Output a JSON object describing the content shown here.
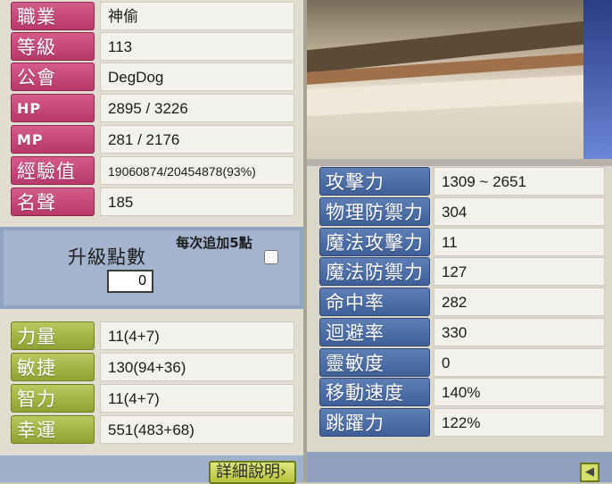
{
  "left": {
    "rows": [
      {
        "label": "職業",
        "value": "神偷"
      },
      {
        "label": "等級",
        "value": "113"
      },
      {
        "label": "公會",
        "value": "DegDog"
      },
      {
        "label": "HP",
        "value": "2895 / 3226"
      },
      {
        "label": "MP",
        "value": "281 / 2176"
      },
      {
        "label": "經驗值",
        "value": "19060874/20454878(93%)"
      },
      {
        "label": "名聲",
        "value": "185"
      }
    ],
    "points": {
      "title": "升級點數",
      "value": "0",
      "each_label": "每次追加5點"
    },
    "stats": [
      {
        "label": "力量",
        "value": "11(4+7)"
      },
      {
        "label": "敏捷",
        "value": "130(94+36)"
      },
      {
        "label": "智力",
        "value": "11(4+7)"
      },
      {
        "label": "幸運",
        "value": "551(483+68)"
      }
    ],
    "detail_button": "詳細說明›"
  },
  "right": {
    "stats": [
      {
        "label": "攻擊力",
        "value": "1309 ~ 2651"
      },
      {
        "label": "物理防禦力",
        "value": "304"
      },
      {
        "label": "魔法攻擊力",
        "value": "11"
      },
      {
        "label": "魔法防禦力",
        "value": "127"
      },
      {
        "label": "命中率",
        "value": "282"
      },
      {
        "label": "迴避率",
        "value": "330"
      },
      {
        "label": "靈敏度",
        "value": "0"
      },
      {
        "label": "移動速度",
        "value": "140%"
      },
      {
        "label": "跳躍力",
        "value": "122%"
      }
    ],
    "arrow_icon": "arrow-left-icon"
  }
}
